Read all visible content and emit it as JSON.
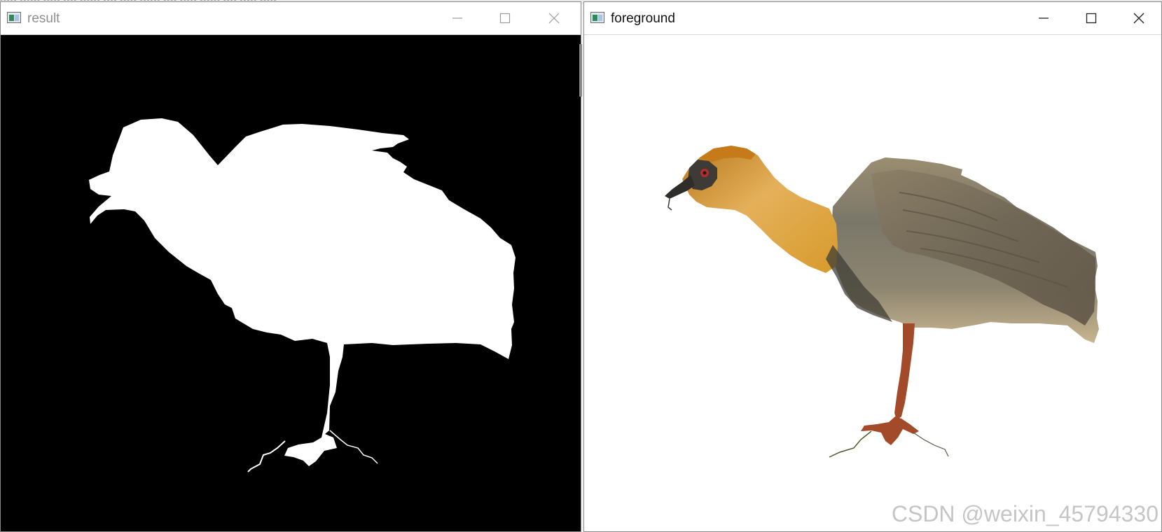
{
  "left_window": {
    "title": "result",
    "controls": [
      "minimize",
      "maximize",
      "close"
    ],
    "content_colors": {
      "background": "#000000",
      "mask": "#ffffff"
    }
  },
  "right_window": {
    "title": "foreground",
    "controls": [
      "minimize",
      "maximize",
      "close"
    ],
    "content_colors": {
      "background": "#ffffff"
    }
  },
  "watermark": "CSDN @weixin_45794330",
  "icons": {
    "window_icon": "opencv-window-icon",
    "minimize": "minimize-icon",
    "maximize": "maximize-icon",
    "close": "close-icon"
  }
}
